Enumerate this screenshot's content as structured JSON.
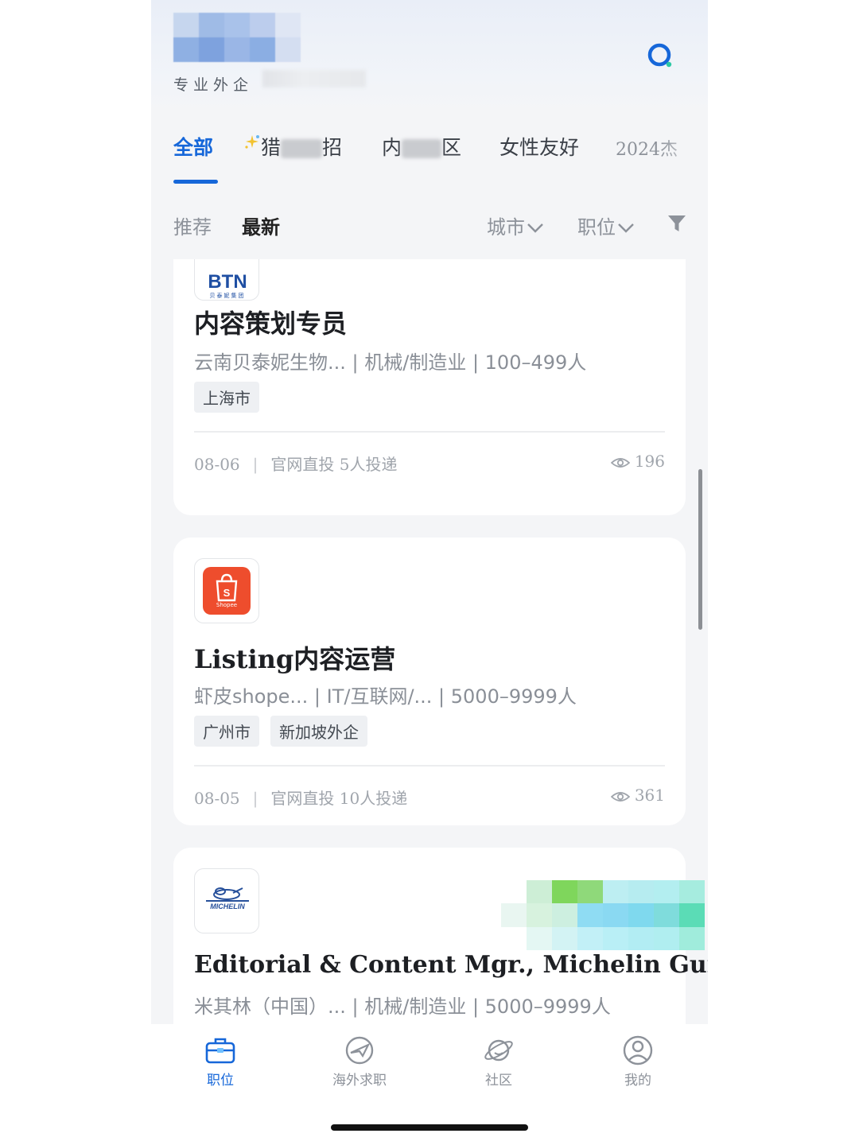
{
  "header": {
    "tagline": "专业外企",
    "search_icon": "search-icon"
  },
  "tabs": [
    {
      "label": "全部",
      "active": true
    },
    {
      "label_prefix": "猎",
      "label_suffix": "招",
      "icon": "sparkle-icon"
    },
    {
      "label_prefix": "内",
      "label_suffix": "区"
    },
    {
      "label": "女性友好"
    },
    {
      "label": "2024杰"
    }
  ],
  "subbar": {
    "sort_recommend": "推荐",
    "sort_latest": "最新",
    "city_filter": "城市",
    "position_filter": "职位",
    "filter_icon": "filter-icon"
  },
  "jobs": [
    {
      "logo_text": "BTN",
      "logo_subtext": "贝泰妮集团",
      "title": "内容策划专员",
      "company_line": "云南贝泰妮生物... | 机械/制造业 | 100–499人",
      "tags": [
        "上海市"
      ],
      "date": "08-06",
      "apply_info": "官网直投  5人投递",
      "views": "196"
    },
    {
      "logo_text": "Shopee",
      "title": "Listing内容运营",
      "company_line": "虾皮shope... | IT/互联网/... | 5000–9999人",
      "tags": [
        "广州市",
        "新加坡外企"
      ],
      "date": "08-05",
      "apply_info": "官网直投  10人投递",
      "views": "361"
    },
    {
      "logo_text": "MICHELIN",
      "title": "Editorial & Content Mgr., Michelin Guide",
      "company_line": "米其林（中国）... | 机械/制造业 | 5000–9999人"
    }
  ],
  "tabbar": [
    {
      "label": "职位",
      "icon": "briefcase-icon",
      "active": true
    },
    {
      "label": "海外求职",
      "icon": "plane-icon"
    },
    {
      "label": "社区",
      "icon": "planet-icon"
    },
    {
      "label": "我的",
      "icon": "user-icon"
    }
  ],
  "colors": {
    "accent": "#1667d9",
    "shopee": "#ee4d2d",
    "btn_blue": "#1f4fa3"
  }
}
